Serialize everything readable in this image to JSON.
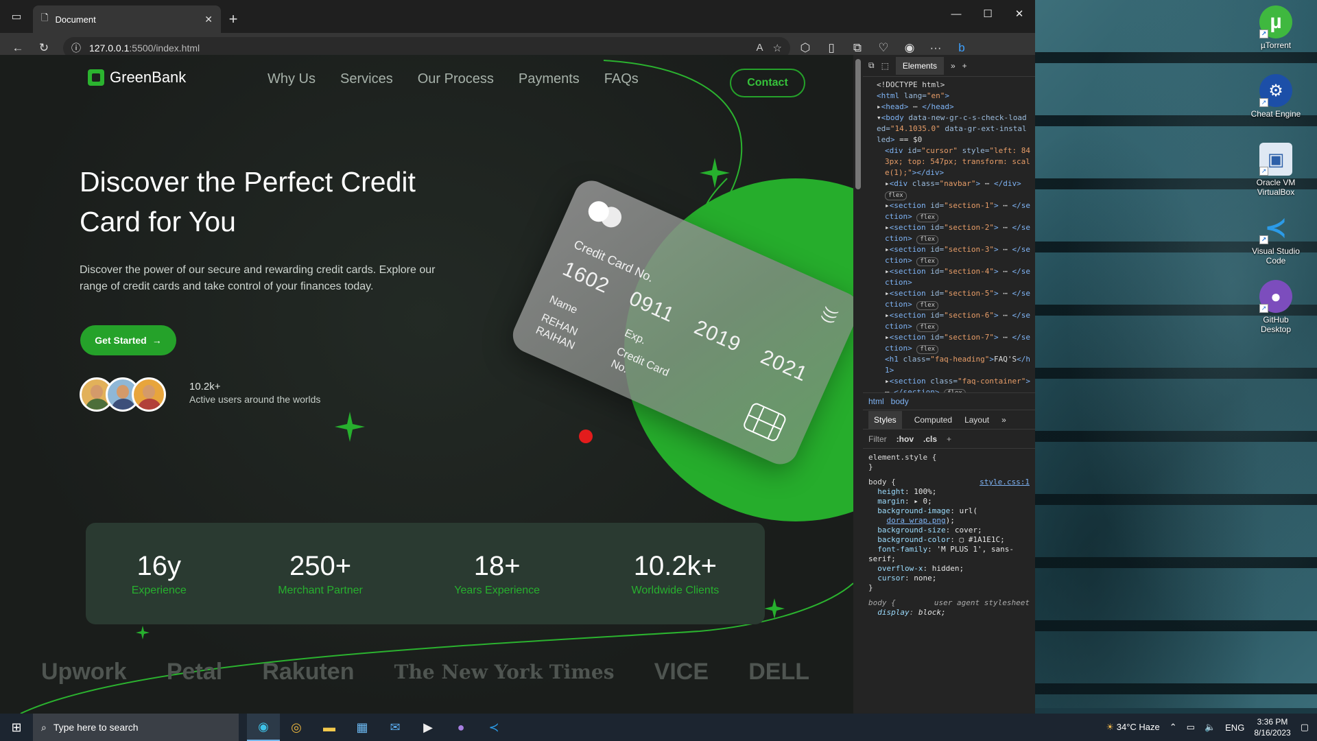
{
  "browser": {
    "tab_title": "Document",
    "address_host": "127.0.0.1",
    "address_path": ":5500/index.html"
  },
  "site": {
    "logo_text": "GreenBank",
    "nav": [
      "Why Us",
      "Services",
      "Our Process",
      "Payments",
      "FAQs"
    ],
    "contact_label": "Contact",
    "hero_title": "Discover the Perfect Credit Card for You",
    "hero_desc": "Discover the power of our secure and rewarding credit cards. Explore our range of credit cards and take control of your finances today.",
    "cta_label": "Get Started",
    "users_count": "10.2k+",
    "users_label": "Active users around the worlds",
    "card": {
      "label": "Credit Card No.",
      "number": "1602 0911 2019 2021",
      "name_label": "Name",
      "name": "REHAN RAIHAN",
      "exp_label": "Exp.",
      "label2": "Credit Card No."
    },
    "stats": [
      {
        "value": "16y",
        "label": "Experience"
      },
      {
        "value": "250+",
        "label": "Merchant Partner"
      },
      {
        "value": "18+",
        "label": "Years Experience"
      },
      {
        "value": "10.2k+",
        "label": "Worldwide Clients"
      }
    ],
    "brands": [
      "Upwork",
      "Petal",
      "Rakuten",
      "The New York Times",
      "VICE",
      "DELL"
    ]
  },
  "devtools": {
    "tab_elements": "Elements",
    "breadcrumb": [
      "html",
      "body"
    ],
    "sub_tabs": [
      "Styles",
      "Computed",
      "Layout"
    ],
    "filter_label": "Filter",
    "hov": ":hov",
    "cls": ".cls",
    "styles_source": "style.css:1",
    "user_agent": "user agent stylesheet"
  },
  "desktop": {
    "icons": [
      "µTorrent",
      "Cheat Engine",
      "Oracle VM VirtualBox",
      "Visual Studio Code",
      "GitHub Desktop"
    ]
  },
  "taskbar": {
    "search_placeholder": "Type here to search",
    "weather": "34°C  Haze",
    "lang": "ENG",
    "time": "3:36 PM",
    "date": "8/16/2023"
  }
}
